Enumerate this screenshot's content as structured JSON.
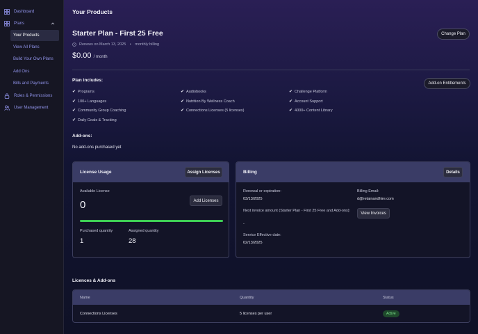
{
  "sidebar": {
    "items": [
      {
        "label": "Dashboard",
        "icon": "grid-icon"
      },
      {
        "label": "Plans",
        "icon": "grid-icon"
      },
      {
        "label": "Your Products"
      },
      {
        "label": "View All Plans"
      },
      {
        "label": "Build Your Own Plans"
      },
      {
        "label": "Add Ons"
      },
      {
        "label": "Bills and Payments"
      },
      {
        "label": "Roles & Permissions",
        "icon": "lock-icon"
      },
      {
        "label": "User Management",
        "icon": "users-icon"
      }
    ]
  },
  "header": {
    "title": "Your Products"
  },
  "plan": {
    "name": "Starter Plan - First 25 Free",
    "renews": "Renews on March 13, 2025",
    "billing": "monthly billing",
    "price": "$0.00",
    "per": "/ month",
    "change_label": "Change Plan",
    "addon_entitlements_label": "Add-on Entitlements",
    "includes_title": "Plan includes:",
    "features": [
      "Programs",
      "Audiobooks",
      "Challenge Platform",
      "100+ Languages",
      "Nutrition By Wellness Coach",
      "Account Support",
      "Community Group Coaching",
      "Connections Licenses (5 licenses)",
      "4000+ Content Library",
      "Daily Goals & Tracking"
    ]
  },
  "addons": {
    "title": "Add-ons:",
    "empty_text": "No add-ons purchased yet"
  },
  "license_usage": {
    "title": "License Usage",
    "assign_label": "Assign Licenses",
    "available_label": "Available License",
    "available_value": "0",
    "add_label": "Add Licenses",
    "usage_fraction": 1.0,
    "purchased_label": "Purchased quantity",
    "purchased_value": "1",
    "assigned_label": "Assigned quantity",
    "assigned_value": "28"
  },
  "billing": {
    "title": "Billing",
    "details_label": "Details",
    "renewal_label": "Renewal or expiration:",
    "renewal_value": "03/13/2025",
    "next_invoice_label": "Next invoice amount (Starter Plan - First 25 Free and Add-ons):",
    "next_invoice_value": "-",
    "effective_label": "Service Effective date:",
    "effective_value": "02/13/2025",
    "email_label": "Billing Email:",
    "email_value": "d@retainandhire.com",
    "view_invoices_label": "View Invoices"
  },
  "licences_table": {
    "title": "Licences & Add-ons",
    "columns": [
      "Name",
      "Quantity",
      "Status"
    ],
    "rows": [
      {
        "name": "Connections Licenses",
        "quantity": "5 licenses per user",
        "status": "Active"
      }
    ]
  },
  "colors": {
    "accent": "#8f92e8",
    "active_green": "#3ecf55"
  }
}
